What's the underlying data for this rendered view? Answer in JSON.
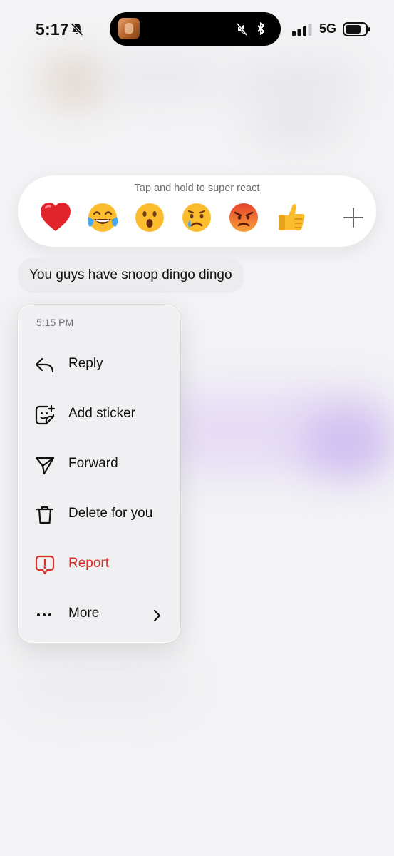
{
  "status_bar": {
    "time": "5:17",
    "network": "5G"
  },
  "reactions": {
    "hint": "Tap and hold to super react",
    "emojis": [
      {
        "name": "red-heart",
        "glyph": "❤️"
      },
      {
        "name": "tears-of-joy",
        "glyph": "😂"
      },
      {
        "name": "astonished",
        "glyph": "😮"
      },
      {
        "name": "crying",
        "glyph": "😢"
      },
      {
        "name": "angry",
        "glyph": "😡"
      },
      {
        "name": "thumbs-up",
        "glyph": "👍"
      }
    ],
    "add_icon": "plus-icon"
  },
  "message": {
    "text": "You guys have snoop dingo dingo"
  },
  "menu": {
    "timestamp": "5:15 PM",
    "items": [
      {
        "label": "Reply",
        "icon": "reply-icon"
      },
      {
        "label": "Add sticker",
        "icon": "sticker-icon"
      },
      {
        "label": "Forward",
        "icon": "send-icon"
      },
      {
        "label": "Delete for you",
        "icon": "trash-icon"
      },
      {
        "label": "Report",
        "icon": "report-icon",
        "color": "#d9302b"
      },
      {
        "label": "More",
        "icon": "more-dots-icon"
      }
    ]
  },
  "colors": {
    "background": "#f3f3f5",
    "danger": "#d9302b",
    "bubble": "#ececee"
  }
}
